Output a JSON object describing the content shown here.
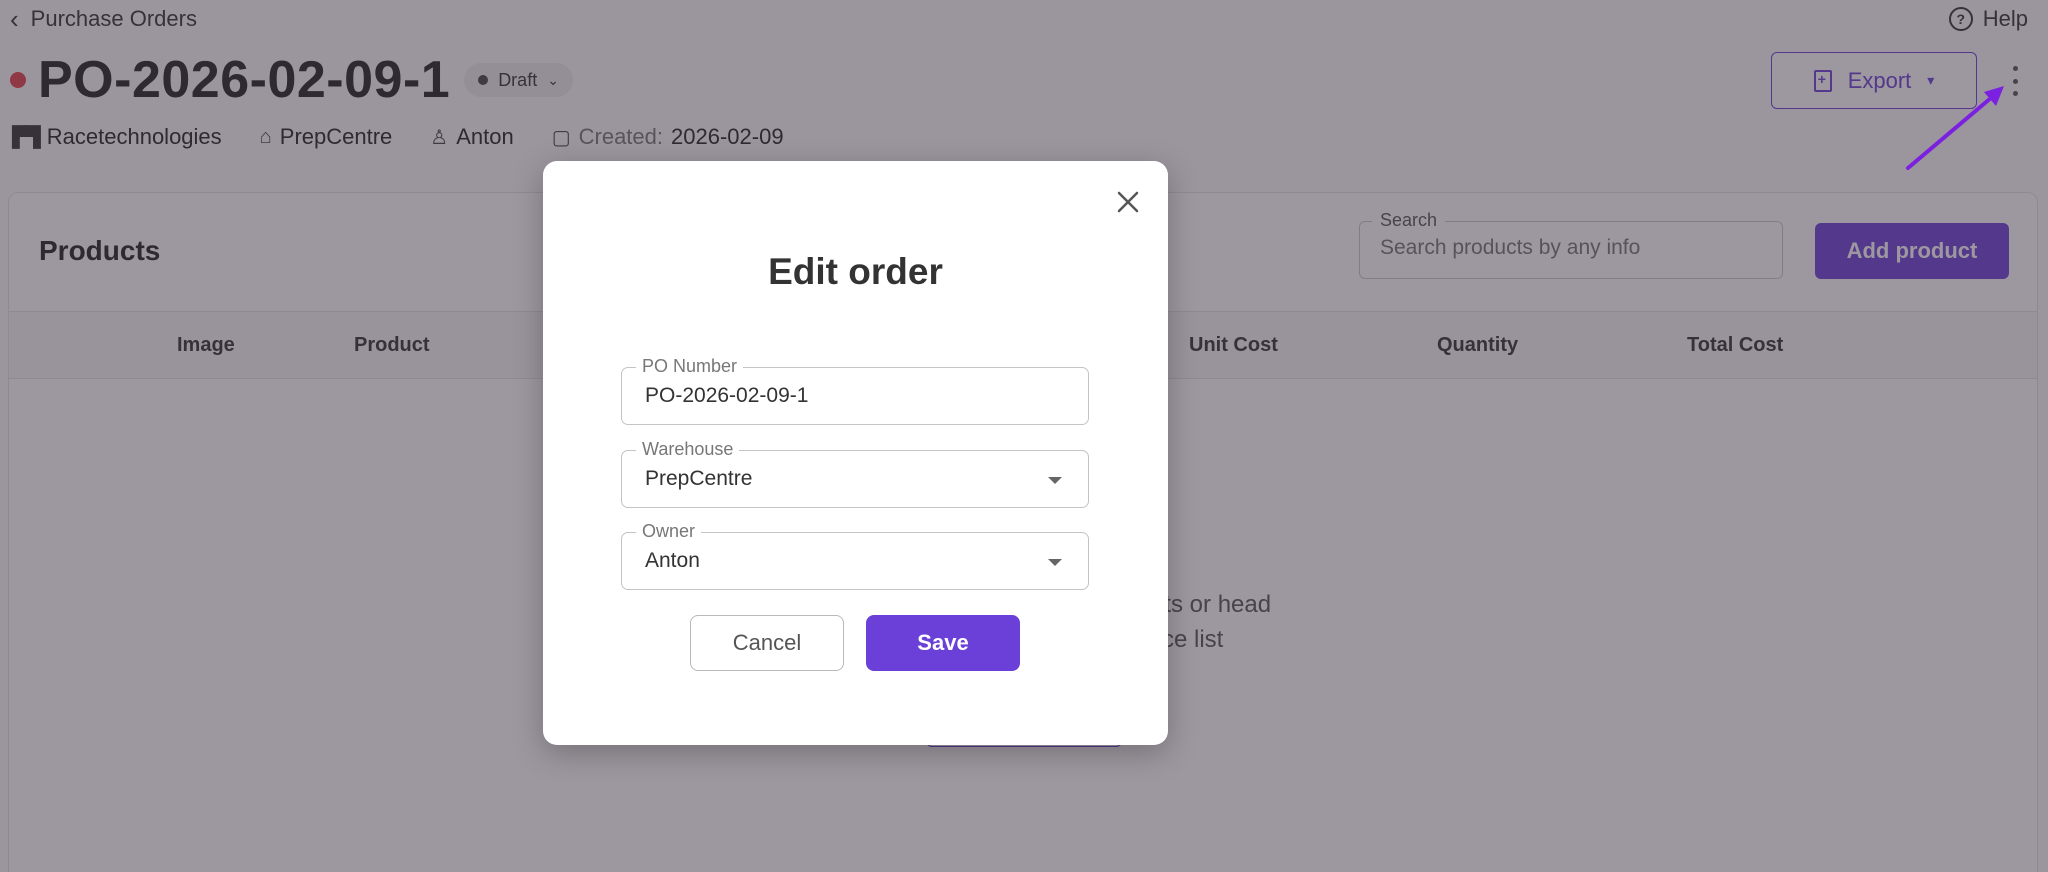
{
  "header": {
    "back_label": "Purchase Orders",
    "help_label": "Help"
  },
  "order": {
    "po_number": "PO-2026-02-09-1",
    "status": "Draft",
    "status_color": "#e3424b",
    "company": "Racetechnologies",
    "warehouse": "PrepCentre",
    "owner": "Anton",
    "created_label": "Created:",
    "created_date": "2026-02-09"
  },
  "toolbar": {
    "export_label": "Export"
  },
  "products": {
    "title": "Products",
    "search_label": "Search",
    "search_placeholder": "Search products by any info",
    "add_label": "Add product",
    "columns": [
      "Image",
      "Product",
      "Unit Cost",
      "Quantity",
      "Total Cost"
    ],
    "empty_line1": "ucts or head",
    "empty_line2": "ce list"
  },
  "modal": {
    "title": "Edit order",
    "fields": {
      "po_number": {
        "label": "PO Number",
        "value": "PO-2026-02-09-1"
      },
      "warehouse": {
        "label": "Warehouse",
        "value": "PrepCentre"
      },
      "owner": {
        "label": "Owner",
        "value": "Anton"
      }
    },
    "cancel_label": "Cancel",
    "save_label": "Save"
  },
  "colors": {
    "accent": "#6a40d8",
    "annotation_arrow": "#7b1fe0"
  }
}
